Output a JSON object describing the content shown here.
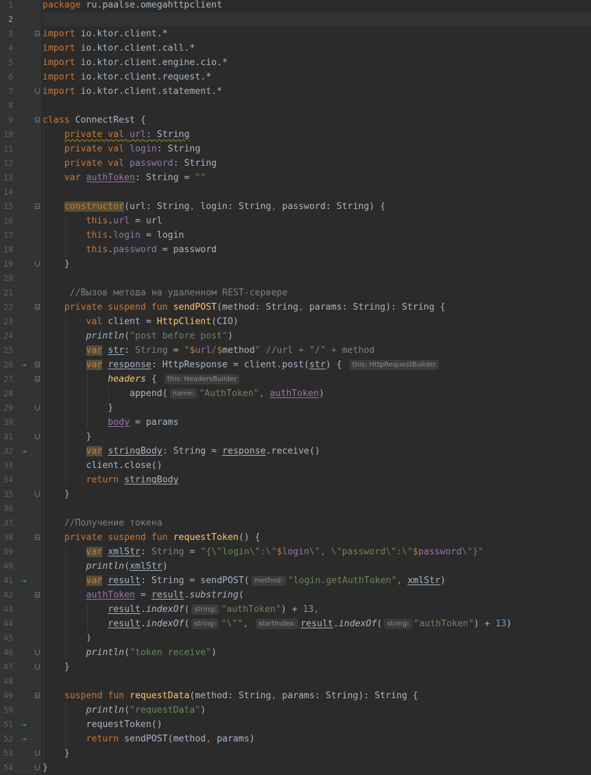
{
  "editor": {
    "language": "Kotlin",
    "colors": {
      "background": "#2b2b2b",
      "keyword": "#cc7832",
      "property": "#9876aa",
      "string": "#6a8759",
      "comment": "#808080",
      "function": "#ffc66d",
      "number": "#6897bb",
      "text": "#a9b7c6"
    },
    "gutter_icons": {
      "suspend_call": "suspend-call-icon"
    },
    "line_numbers": [
      "1",
      "2",
      "3",
      "4",
      "5",
      "6",
      "7",
      "8",
      "9",
      "10",
      "11",
      "12",
      "13",
      "14",
      "15",
      "16",
      "17",
      "18",
      "19",
      "20",
      "21",
      "22",
      "23",
      "24",
      "25",
      "26",
      "27",
      "28",
      "29",
      "30",
      "31",
      "32",
      "33",
      "34",
      "35",
      "36",
      "37",
      "38",
      "39",
      "40",
      "41",
      "42",
      "43",
      "44",
      "45",
      "46",
      "47",
      "48",
      "49",
      "50",
      "51",
      "52",
      "53",
      "54"
    ],
    "lines": [
      [
        {
          "t": "package",
          "c": "kw"
        },
        {
          "t": " ru.paalse.omegahttpclient"
        }
      ],
      [],
      [
        {
          "t": "import",
          "c": "kw"
        },
        {
          "t": " io.ktor.client.*"
        }
      ],
      [
        {
          "t": "import",
          "c": "kw"
        },
        {
          "t": " io.ktor.client.call.*"
        }
      ],
      [
        {
          "t": "import",
          "c": "kw"
        },
        {
          "t": " io.ktor.client.engine.cio.*"
        }
      ],
      [
        {
          "t": "import",
          "c": "kw"
        },
        {
          "t": " io.ktor.client.request.*"
        }
      ],
      [
        {
          "t": "import",
          "c": "kw"
        },
        {
          "t": " io.ktor.client.statement.*"
        }
      ],
      [],
      [
        {
          "t": "class",
          "c": "kw"
        },
        {
          "t": " ConnectRest {"
        }
      ],
      [
        {
          "t": "    "
        },
        {
          "t": "private val ",
          "c": "kw squig"
        },
        {
          "t": "url",
          "c": "pr squig"
        },
        {
          "t": ": String",
          "c": "squig"
        }
      ],
      [
        {
          "t": "    "
        },
        {
          "t": "private val ",
          "c": "kw"
        },
        {
          "t": "login",
          "c": "pr"
        },
        {
          "t": ": String"
        }
      ],
      [
        {
          "t": "    "
        },
        {
          "t": "private val ",
          "c": "kw"
        },
        {
          "t": "password",
          "c": "pr"
        },
        {
          "t": ": String"
        }
      ],
      [
        {
          "t": "    "
        },
        {
          "t": "var ",
          "c": "kw"
        },
        {
          "t": "authToken",
          "c": "pr ul"
        },
        {
          "t": ": String = "
        },
        {
          "t": "\"\"",
          "c": "str"
        }
      ],
      [],
      [
        {
          "t": "    "
        },
        {
          "t": "constructor",
          "c": "kw hl"
        },
        {
          "t": "(url: String"
        },
        {
          "t": ", ",
          "c": "kw"
        },
        {
          "t": "login: String"
        },
        {
          "t": ", ",
          "c": "kw"
        },
        {
          "t": "password: String) {"
        }
      ],
      [
        {
          "t": "        "
        },
        {
          "t": "this",
          "c": "kw"
        },
        {
          "t": "."
        },
        {
          "t": "url",
          "c": "pr"
        },
        {
          "t": " = url"
        }
      ],
      [
        {
          "t": "        "
        },
        {
          "t": "this",
          "c": "kw"
        },
        {
          "t": "."
        },
        {
          "t": "login",
          "c": "pr"
        },
        {
          "t": " = login"
        }
      ],
      [
        {
          "t": "        "
        },
        {
          "t": "this",
          "c": "kw"
        },
        {
          "t": "."
        },
        {
          "t": "password",
          "c": "pr"
        },
        {
          "t": " = password"
        }
      ],
      [
        {
          "t": "    }"
        }
      ],
      [],
      [
        {
          "t": "     "
        },
        {
          "t": "//Вызов метода на удаленном REST-сервере",
          "c": "com"
        }
      ],
      [
        {
          "t": "    "
        },
        {
          "t": "private suspend fun ",
          "c": "kw"
        },
        {
          "t": "sendPOST",
          "c": "fn"
        },
        {
          "t": "(method: String"
        },
        {
          "t": ", ",
          "c": "kw"
        },
        {
          "t": "params: String): String {"
        }
      ],
      [
        {
          "t": "        "
        },
        {
          "t": "val ",
          "c": "kw"
        },
        {
          "t": "client = "
        },
        {
          "t": "HttpClient",
          "c": "fn"
        },
        {
          "t": "(CIO)"
        }
      ],
      [
        {
          "t": "        "
        },
        {
          "t": "println",
          "c": "it"
        },
        {
          "t": "("
        },
        {
          "t": "\"post before post\"",
          "c": "str"
        },
        {
          "t": ")"
        }
      ],
      [
        {
          "t": "        "
        },
        {
          "t": "var",
          "c": "kw hl"
        },
        {
          "t": " "
        },
        {
          "t": "str",
          "c": "ul"
        },
        {
          "t": ": "
        },
        {
          "t": "String",
          "c": "unused"
        },
        {
          "t": " = "
        },
        {
          "t": "\"",
          "c": "str"
        },
        {
          "t": "$",
          "c": "kw"
        },
        {
          "t": "url",
          "c": "pr"
        },
        {
          "t": "/",
          "c": "str"
        },
        {
          "t": "$",
          "c": "kw"
        },
        {
          "t": "method"
        },
        {
          "t": "\"",
          "c": "str"
        },
        {
          "t": " //url + \"/\" + method",
          "c": "com"
        }
      ],
      [
        {
          "t": "        "
        },
        {
          "t": "var",
          "c": "kw hl"
        },
        {
          "t": " "
        },
        {
          "t": "response",
          "c": "ul"
        },
        {
          "t": ": HttpResponse = client.post("
        },
        {
          "t": "str",
          "c": "ul"
        },
        {
          "t": ") { "
        },
        {
          "h": "this: HttpRequestBuilder"
        }
      ],
      [
        {
          "t": "            "
        },
        {
          "t": "headers",
          "c": "fnit"
        },
        {
          "t": " { "
        },
        {
          "h": "this: HeadersBuilder"
        }
      ],
      [
        {
          "t": "                "
        },
        {
          "t": "append("
        },
        {
          "h": "name:"
        },
        {
          "t": "\"AuthToken\"",
          "c": "str"
        },
        {
          "t": ", ",
          "c": "kw"
        },
        {
          "t": "authToken",
          "c": "pr ul"
        },
        {
          "t": ")"
        }
      ],
      [
        {
          "t": "            }"
        }
      ],
      [
        {
          "t": "            "
        },
        {
          "t": "body",
          "c": "pr ul"
        },
        {
          "t": " = params"
        }
      ],
      [
        {
          "t": "        }"
        }
      ],
      [
        {
          "t": "        "
        },
        {
          "t": "var",
          "c": "kw hl"
        },
        {
          "t": " "
        },
        {
          "t": "stringBody",
          "c": "ul"
        },
        {
          "t": ": String = "
        },
        {
          "t": "response",
          "c": "ul"
        },
        {
          "t": ".receive()"
        }
      ],
      [
        {
          "t": "        "
        },
        {
          "t": "client.close()"
        }
      ],
      [
        {
          "t": "        "
        },
        {
          "t": "return ",
          "c": "kw"
        },
        {
          "t": "stringBody",
          "c": "ul"
        }
      ],
      [
        {
          "t": "    }"
        }
      ],
      [],
      [
        {
          "t": "    "
        },
        {
          "t": "//Получение токена",
          "c": "com"
        }
      ],
      [
        {
          "t": "    "
        },
        {
          "t": "private suspend fun ",
          "c": "kw"
        },
        {
          "t": "requestToken",
          "c": "fn"
        },
        {
          "t": "() {"
        }
      ],
      [
        {
          "t": "        "
        },
        {
          "t": "var",
          "c": "kw hl"
        },
        {
          "t": " "
        },
        {
          "t": "xmlStr",
          "c": "ul"
        },
        {
          "t": ": "
        },
        {
          "t": "String",
          "c": "unused"
        },
        {
          "t": " = "
        },
        {
          "t": "\"{\\\"login\\\":\\\"",
          "c": "str"
        },
        {
          "t": "$",
          "c": "kw"
        },
        {
          "t": "login",
          "c": "pr"
        },
        {
          "t": "\\\", \\\"password\\\":\\\"",
          "c": "str"
        },
        {
          "t": "$",
          "c": "kw"
        },
        {
          "t": "password",
          "c": "pr"
        },
        {
          "t": "\\\"}\"",
          "c": "str"
        }
      ],
      [
        {
          "t": "        "
        },
        {
          "t": "println",
          "c": "it"
        },
        {
          "t": "("
        },
        {
          "t": "xmlStr",
          "c": "ul"
        },
        {
          "t": ")"
        }
      ],
      [
        {
          "t": "        "
        },
        {
          "t": "var",
          "c": "kw hl"
        },
        {
          "t": " "
        },
        {
          "t": "result",
          "c": "ul"
        },
        {
          "t": ": String = sendPOST("
        },
        {
          "h": "method:"
        },
        {
          "t": "\"login.getAuthToken\"",
          "c": "str"
        },
        {
          "t": ", ",
          "c": "kw"
        },
        {
          "t": "xmlStr",
          "c": "ul"
        },
        {
          "t": ")"
        }
      ],
      [
        {
          "t": "        "
        },
        {
          "t": "authToken",
          "c": "pr ul"
        },
        {
          "t": " = "
        },
        {
          "t": "result",
          "c": "ul"
        },
        {
          "t": "."
        },
        {
          "t": "substring",
          "c": "it"
        },
        {
          "t": "("
        }
      ],
      [
        {
          "t": "            "
        },
        {
          "t": "result",
          "c": "ul"
        },
        {
          "t": "."
        },
        {
          "t": "indexOf",
          "c": "it"
        },
        {
          "t": "("
        },
        {
          "h": "string:"
        },
        {
          "t": "\"authToken\"",
          "c": "str"
        },
        {
          "t": ") + "
        },
        {
          "t": "13",
          "c": "num"
        },
        {
          "t": ",",
          "c": "kw"
        }
      ],
      [
        {
          "t": "            "
        },
        {
          "t": "result",
          "c": "ul"
        },
        {
          "t": "."
        },
        {
          "t": "indexOf",
          "c": "it"
        },
        {
          "t": "("
        },
        {
          "h": "string:"
        },
        {
          "t": "\"\\\"\"",
          "c": "str"
        },
        {
          "t": ", ",
          "c": "kw"
        },
        {
          "h": "startIndex:"
        },
        {
          "t": "result",
          "c": "ul"
        },
        {
          "t": "."
        },
        {
          "t": "indexOf",
          "c": "it"
        },
        {
          "t": "("
        },
        {
          "h": "string:"
        },
        {
          "t": "\"authToken\"",
          "c": "str"
        },
        {
          "t": ") + "
        },
        {
          "t": "13",
          "c": "num"
        },
        {
          "t": ")"
        }
      ],
      [
        {
          "t": "        )"
        }
      ],
      [
        {
          "t": "        "
        },
        {
          "t": "println",
          "c": "it"
        },
        {
          "t": "("
        },
        {
          "t": "\"token receive\"",
          "c": "str"
        },
        {
          "t": ")"
        }
      ],
      [
        {
          "t": "    }"
        }
      ],
      [],
      [
        {
          "t": "    "
        },
        {
          "t": "suspend fun ",
          "c": "kw"
        },
        {
          "t": "requestData",
          "c": "fn"
        },
        {
          "t": "(method: String"
        },
        {
          "t": ", ",
          "c": "kw"
        },
        {
          "t": "params: String): String {"
        }
      ],
      [
        {
          "t": "        "
        },
        {
          "t": "println",
          "c": "it"
        },
        {
          "t": "("
        },
        {
          "t": "\"requestData\"",
          "c": "str"
        },
        {
          "t": ")"
        }
      ],
      [
        {
          "t": "        "
        },
        {
          "t": "requestToken()"
        }
      ],
      [
        {
          "t": "        "
        },
        {
          "t": "return ",
          "c": "kw"
        },
        {
          "t": "sendPOST(method"
        },
        {
          "t": ", ",
          "c": "kw"
        },
        {
          "t": "params)"
        }
      ],
      [
        {
          "t": "    }"
        }
      ],
      [
        {
          "t": "}"
        }
      ]
    ]
  }
}
